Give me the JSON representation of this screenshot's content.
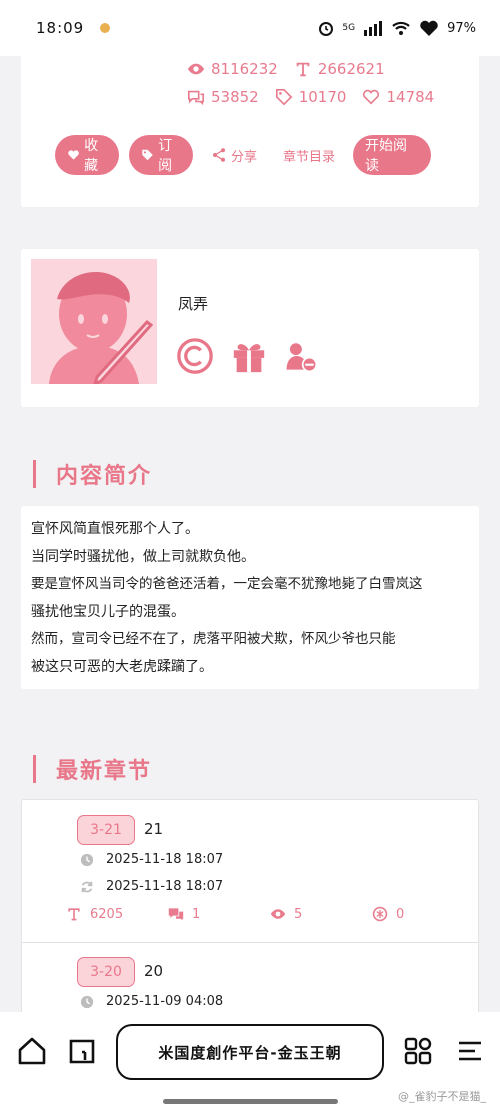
{
  "status_bar": {
    "time": "18:09",
    "network": "5G",
    "battery": "97%"
  },
  "stats": {
    "views": "8116232",
    "words": "2662621",
    "comments": "53852",
    "tags": "10170",
    "likes": "14784"
  },
  "actions": {
    "favorite": "收藏",
    "subscribe": "订阅",
    "share": "分享",
    "toc": "章节目录",
    "start_read": "开始阅读"
  },
  "author": {
    "name": "凤弄",
    "badges": [
      "copyright-icon",
      "gift-icon",
      "fan-icon"
    ]
  },
  "intro": {
    "title": "内容简介",
    "lines": [
      "宣怀风简直恨死那个人了。",
      "当同学时骚扰他，做上司就欺负他。",
      "要是宣怀风当司令的爸爸还活着，一定会毫不犹豫地毙了白雪岚这",
      "骚扰他宝贝儿子的混蛋。",
      "然而，宣司令已经不在了，虎落平阳被犬欺，怀风少爷也只能",
      "被这只可恶的大老虎蹂躏了。"
    ]
  },
  "latest": {
    "title": "最新章节",
    "chapters": [
      {
        "tag": "3-21",
        "number": "21",
        "created": "2025-11-18 18:07",
        "updated": "2025-11-18 18:07",
        "words": "6205",
        "comments": "1",
        "views": "5",
        "coins": "0"
      },
      {
        "tag": "3-20",
        "number": "20",
        "created": "2025-11-09 04:08"
      }
    ]
  },
  "bottom_bar": {
    "site_title": "米国度創作平台-金玉王朝"
  },
  "watermark": "@_雀豹子不是猫_",
  "colors": {
    "accent": "#e9778a",
    "accent_light": "#fbd4da"
  }
}
